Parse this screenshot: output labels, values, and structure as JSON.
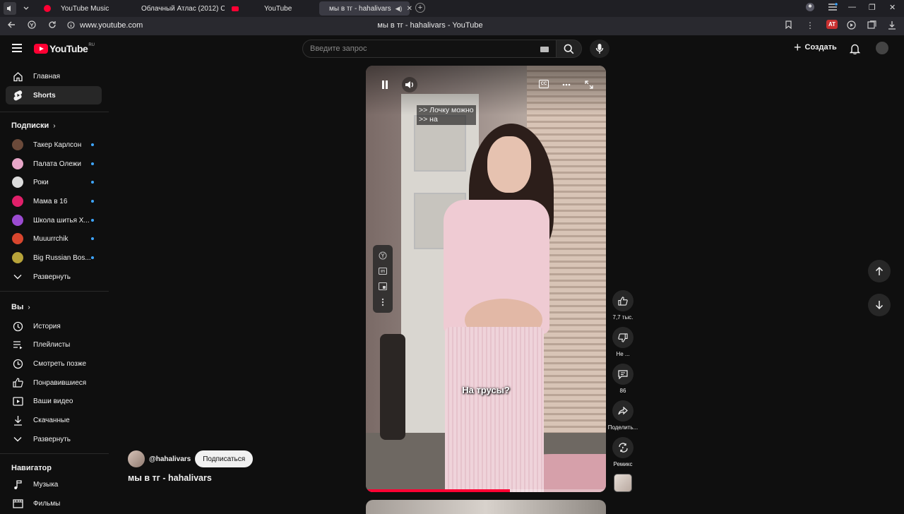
{
  "browser": {
    "tabs": [
      {
        "label": "YouTube Music",
        "color": "#ff0033"
      },
      {
        "label": "Облачный Атлас (2012) С",
        "color": "#2a9d3a"
      },
      {
        "label": "YouTube",
        "color": "#ff0033"
      },
      {
        "label": "мы в тг - hahalivars",
        "color": "#ff0033"
      }
    ],
    "url": "www.youtube.com",
    "page_title": "мы в тг - hahalivars - YouTube",
    "ext_badge": "AT"
  },
  "header": {
    "logo_text": "YouTube",
    "logo_region": "RU",
    "search_placeholder": "Введите запрос",
    "create_label": "Создать"
  },
  "sidebar": {
    "main": [
      {
        "label": "Главная",
        "icon": "home-icon"
      },
      {
        "label": "Shorts",
        "icon": "shorts-icon"
      }
    ],
    "subscriptions_title": "Подписки",
    "subscriptions": [
      {
        "label": "Такер Карлсон",
        "color": "#6b4a3a"
      },
      {
        "label": "Палата Олежи",
        "color": "#e7a6c8"
      },
      {
        "label": "Роки",
        "color": "#dcdcdc"
      },
      {
        "label": "Мама в 16",
        "color": "#e0206a"
      },
      {
        "label": "Школа шитья Х...",
        "color": "#9b4bd1"
      },
      {
        "label": "Muuurrchik",
        "color": "#d8462e"
      },
      {
        "label": "Big Russian Bos...",
        "color": "#b7a33a"
      }
    ],
    "expand_label": "Развернуть",
    "you_title": "Вы",
    "you": [
      {
        "label": "История",
        "icon": "history-icon"
      },
      {
        "label": "Плейлисты",
        "icon": "playlists-icon"
      },
      {
        "label": "Смотреть позже",
        "icon": "watch-later-icon"
      },
      {
        "label": "Понравившиеся",
        "icon": "like-icon"
      },
      {
        "label": "Ваши видео",
        "icon": "your-videos-icon"
      },
      {
        "label": "Скачанные",
        "icon": "download-icon"
      }
    ],
    "expand_label_2": "Развернуть",
    "navigator_title": "Навигатор",
    "navigator": [
      {
        "label": "Музыка",
        "icon": "music-icon"
      },
      {
        "label": "Фильмы",
        "icon": "film-icon"
      }
    ]
  },
  "player": {
    "subtitle_lines": [
      ">> Лочку можно",
      ">> на"
    ],
    "caption": "На трусы?",
    "progress": 0.6
  },
  "actions": {
    "likes": "7,7 тыс.",
    "dislike": "Не ...",
    "comments": "86",
    "share": "Поделить...",
    "remix": "Ремикс"
  },
  "video": {
    "channel": "@hahalivars",
    "subscribe_label": "Подписаться",
    "title": "мы в тг - hahalivars"
  }
}
